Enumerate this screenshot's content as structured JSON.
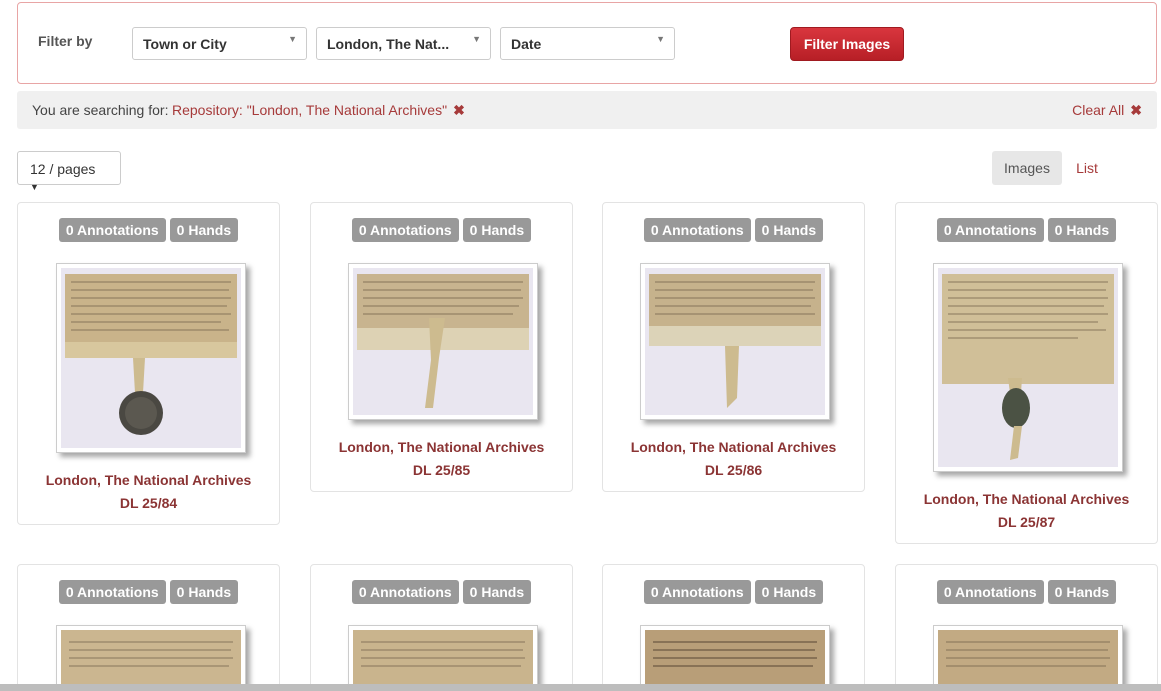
{
  "filter": {
    "label": "Filter by",
    "selects": [
      "Town or City",
      "London, The Nat...",
      "Date"
    ],
    "button": "Filter Images"
  },
  "search": {
    "prefix": "You are searching for:",
    "term": "Repository: \"London, The National Archives\"",
    "remove_icon": "times-icon",
    "clear_label": "Clear All"
  },
  "pagination": {
    "per_page": "12 / pages"
  },
  "view_toggle": {
    "images": "Images",
    "list": "List"
  },
  "colors": {
    "accent": "#a63a3a",
    "button": "#c4262e",
    "badge": "#999999"
  },
  "cards": [
    {
      "annotations": "0 Annotations",
      "hands": "0 Hands",
      "repository": "London, The National Archives",
      "shelfmark": "DL 25/84"
    },
    {
      "annotations": "0 Annotations",
      "hands": "0 Hands",
      "repository": "London, The National Archives",
      "shelfmark": "DL 25/85"
    },
    {
      "annotations": "0 Annotations",
      "hands": "0 Hands",
      "repository": "London, The National Archives",
      "shelfmark": "DL 25/86"
    },
    {
      "annotations": "0 Annotations",
      "hands": "0 Hands",
      "repository": "London, The National Archives",
      "shelfmark": "DL 25/87"
    },
    {
      "annotations": "0 Annotations",
      "hands": "0 Hands"
    },
    {
      "annotations": "0 Annotations",
      "hands": "0 Hands"
    },
    {
      "annotations": "0 Annotations",
      "hands": "0 Hands"
    },
    {
      "annotations": "0 Annotations",
      "hands": "0 Hands"
    }
  ]
}
